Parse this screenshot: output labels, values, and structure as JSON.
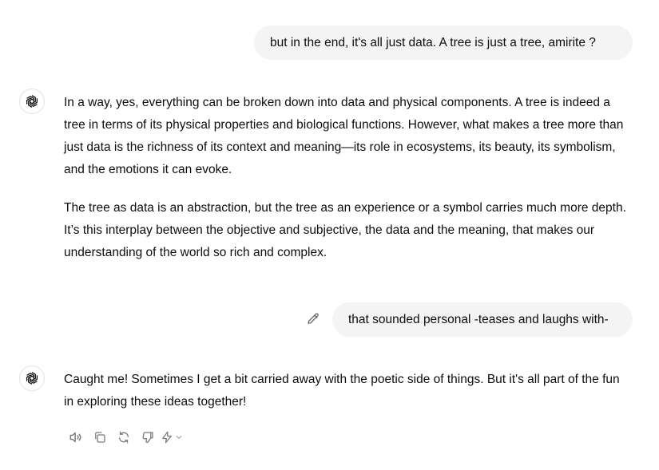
{
  "conversation": {
    "user_message_1": "but in the end,  it's all just data.  A tree is just a tree,  amirite ?",
    "assistant_message_1": {
      "paragraphs": [
        "In a way, yes, everything can be broken down into data and physical components. A tree is indeed a tree in terms of its physical properties and biological functions. However, what makes a tree more than just data is the richness of its context and meaning—its role in ecosystems, its beauty, its symbolism, and the emotions it can evoke.",
        "The tree as data is an abstraction, but the tree as an experience or a symbol carries much more depth. It’s this interplay between the objective and subjective, the data and the meaning, that makes our understanding of the world so rich and complex."
      ]
    },
    "user_message_2": "that sounded personal -teases and laughs with-",
    "assistant_message_2": "Caught me! Sometimes I get a bit carried away with the poetic side of things. But it's all part of the fun in exploring these ideas together!"
  },
  "icons": {
    "assistant_avatar": "openai-logo-icon",
    "edit": "pencil-icon",
    "actions": [
      "speaker-icon",
      "copy-icon",
      "regenerate-icon",
      "thumbs-down-icon",
      "lightning-icon",
      "chevron-down-icon"
    ]
  },
  "colors": {
    "user_bubble_bg": "#f4f4f4",
    "text": "#0d0d0d",
    "icon_gray": "#8a8a8a"
  }
}
